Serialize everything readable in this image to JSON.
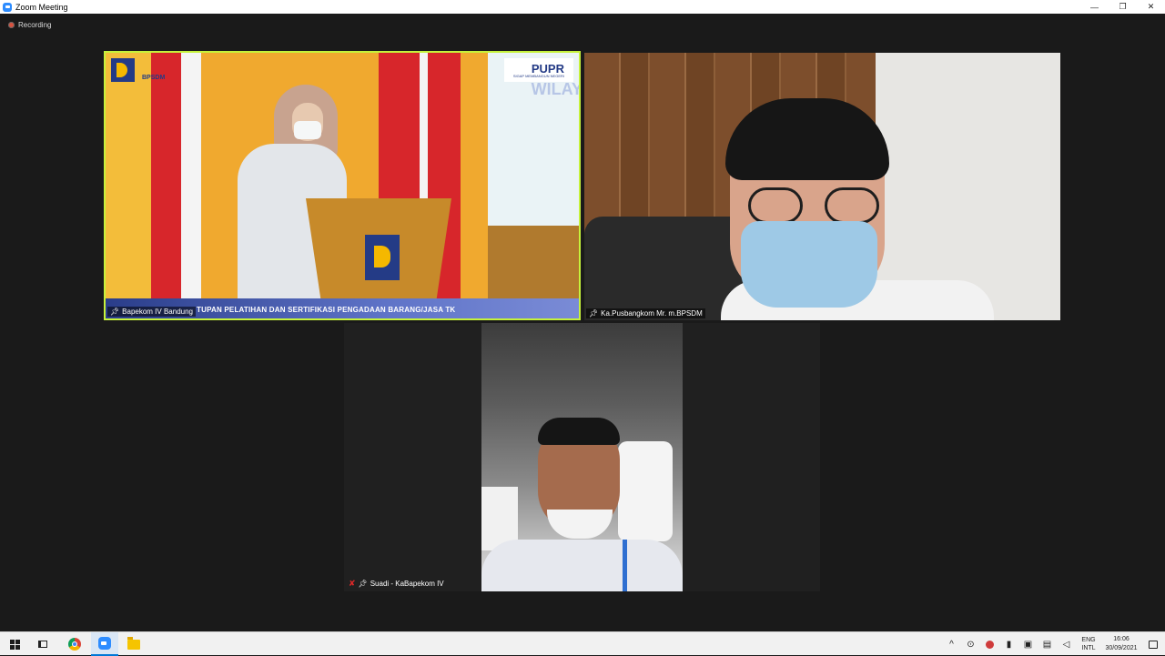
{
  "window": {
    "title": "Zoom Meeting",
    "minimize": "—",
    "restore": "❐",
    "close": "✕"
  },
  "meeting": {
    "recording_label": "Recording"
  },
  "tiles": [
    {
      "name": "Bapekom IV Bandung",
      "banner_text": "TUPAN PELATIHAN DAN SERTIFIKASI PENGADAAN BARANG/JASA TK",
      "logo_left_text": "BPSDM",
      "logo_right_text": "PUPR",
      "logo_right_sub": "SIGAP MEMBANGUN NEGERI",
      "backdrop_text": "WILAY",
      "active_speaker": true,
      "accent_color": "#c6f23b"
    },
    {
      "name": "Ka.Pusbangkom Mr. m.BPSDM"
    },
    {
      "name": "Suadi - KaBapekom IV",
      "muted": true
    }
  ],
  "taskbar": {
    "apps": [
      "start-icon",
      "task-view-icon",
      "chrome-icon",
      "zoom-icon",
      "file-explorer-icon"
    ],
    "tray": {
      "chevron": "^",
      "language_line1": "ENG",
      "language_line2": "INTL",
      "time": "16:06",
      "date": "30/09/2021"
    }
  }
}
